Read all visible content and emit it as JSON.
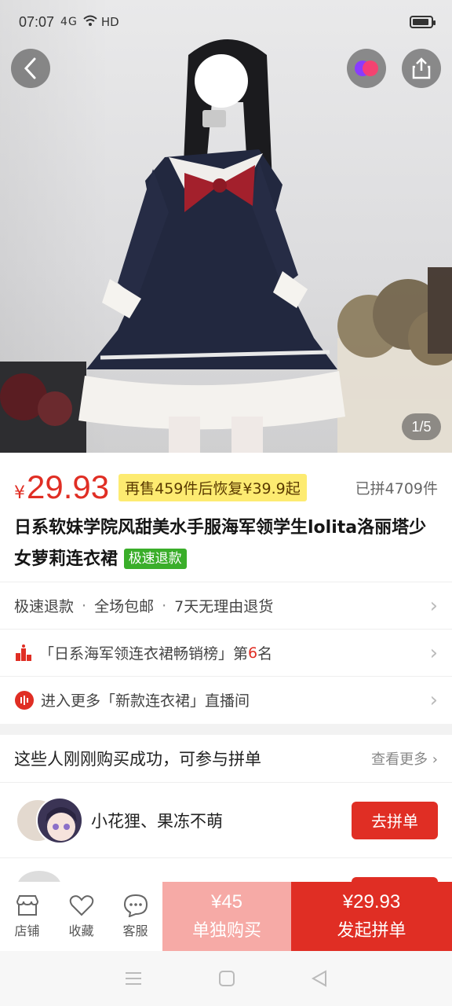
{
  "status_bar": {
    "time": "07:07",
    "signal": "4G",
    "network": "HD"
  },
  "gallery": {
    "page_indicator": "1/5"
  },
  "price": {
    "currency": "¥",
    "current": "29.93",
    "promo": "再售459件后恢复¥39.9起",
    "sold": "已拼4709件"
  },
  "product": {
    "title": "日系软妹学院风甜美水手服海军领学生lolita洛丽塔少女萝莉连衣裙",
    "tag": "极速退款"
  },
  "services": {
    "items": [
      "极速退款",
      "全场包邮",
      "7天无理由退货"
    ]
  },
  "ranking": {
    "prefix": "「日系海军领连衣裙畅销榜」第",
    "rank": "6",
    "suffix": "名"
  },
  "live": {
    "text": "进入更多「新款连衣裙」直播间"
  },
  "group": {
    "heading": "这些人刚刚购买成功，可参与拼单",
    "more": "查看更多",
    "names": "小花狸、果冻不萌",
    "join_label": "去拼单"
  },
  "bottom_bar": {
    "store": "店铺",
    "favorite": "收藏",
    "service": "客服",
    "alone_price": "¥45",
    "alone_label": "单独购买",
    "group_price": "¥29.93",
    "group_label": "发起拼单"
  },
  "colors": {
    "accent": "#e02e24",
    "promo_bg": "#fdeb71",
    "tag_green": "#3aae2a"
  }
}
